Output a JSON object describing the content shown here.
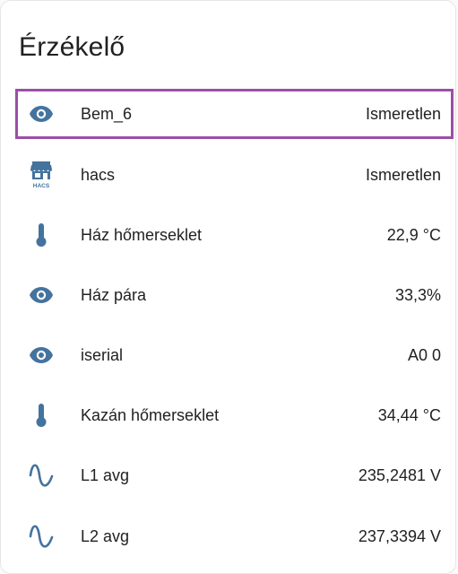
{
  "card": {
    "title": "Érzékelő"
  },
  "entities": [
    {
      "icon": "eye-icon",
      "name": "Bem_6",
      "value": "Ismeretlen",
      "selected": true
    },
    {
      "icon": "hacs-store-icon",
      "icon_text": "HACS",
      "name": "hacs",
      "value": "Ismeretlen"
    },
    {
      "icon": "thermometer-icon",
      "name": "Ház hőmerseklet",
      "value": "22,9 °C"
    },
    {
      "icon": "eye-icon",
      "name": "Ház pára",
      "value": "33,3%"
    },
    {
      "icon": "eye-icon",
      "name": "iserial",
      "value": "A0 0"
    },
    {
      "icon": "thermometer-icon",
      "name": "Kazán hőmerseklet",
      "value": "34,44 °C"
    },
    {
      "icon": "sine-wave-icon",
      "name": "L1 avg",
      "value": "235,2481 V"
    },
    {
      "icon": "sine-wave-icon",
      "name": "L2 avg",
      "value": "237,3394 V"
    }
  ],
  "colors": {
    "icon": "#44739e",
    "selection_border": "#9b4fa7",
    "text": "#212121"
  }
}
